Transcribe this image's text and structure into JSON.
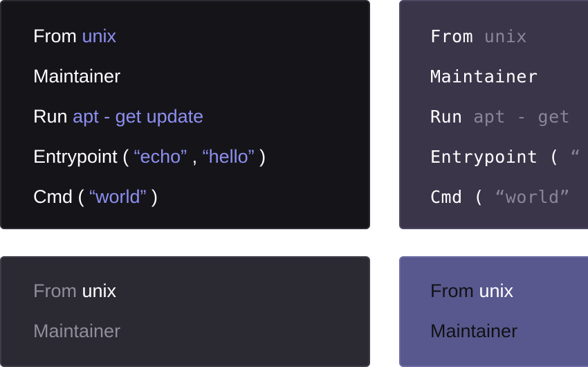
{
  "cards": [
    {
      "lines": [
        {
          "k": "From ",
          "v": "unix"
        },
        {
          "k": "Maintainer"
        },
        {
          "k": "Run ",
          "v": "apt - get update"
        },
        {
          "k": "Entrypoint ( ",
          "v1": "“echo”",
          "sep": " , ",
          "v2": "“hello”",
          "end": " )"
        },
        {
          "k": "Cmd ( ",
          "v": "“world”",
          "end": " )"
        }
      ]
    },
    {
      "lines": [
        {
          "k": "From ",
          "v": "unix"
        },
        {
          "k": "Maintainer"
        },
        {
          "k": "Run ",
          "v": "apt - get"
        },
        {
          "k": "Entrypoint ( ",
          "v": "“"
        },
        {
          "k": "Cmd ( ",
          "v": "“world”"
        }
      ]
    },
    {
      "lines": [
        {
          "k": "From ",
          "v": "unix"
        },
        {
          "k": "Maintainer"
        }
      ]
    },
    {
      "lines": [
        {
          "k": "From ",
          "v": "unix"
        },
        {
          "k": "Maintainer"
        }
      ]
    }
  ]
}
